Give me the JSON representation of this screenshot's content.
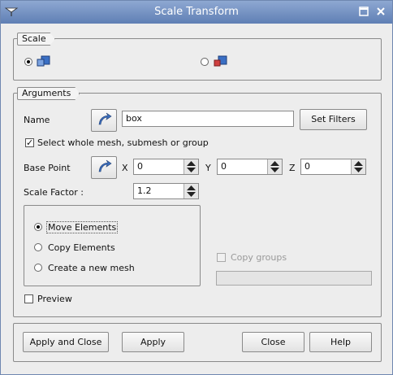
{
  "window": {
    "title": "Scale Transform"
  },
  "scale_group": {
    "title": "Scale",
    "selected": "scale-mode-1"
  },
  "arguments": {
    "title": "Arguments",
    "name_label": "Name",
    "name_value": "box",
    "set_filters": "Set Filters",
    "select_whole": "Select whole mesh, submesh or group",
    "base_point_label": "Base Point",
    "x_label": "X",
    "x_value": "0",
    "y_label": "Y",
    "y_value": "0",
    "z_label": "Z",
    "z_value": "0",
    "scale_factor_label": "Scale Factor :",
    "scale_factor_value": "1.2",
    "options": [
      "Move Elements",
      "Copy Elements",
      "Create a new mesh"
    ],
    "copy_groups": "Copy groups",
    "preview": "Preview"
  },
  "buttons": {
    "apply_close": "Apply and Close",
    "apply": "Apply",
    "close": "Close",
    "help": "Help"
  }
}
